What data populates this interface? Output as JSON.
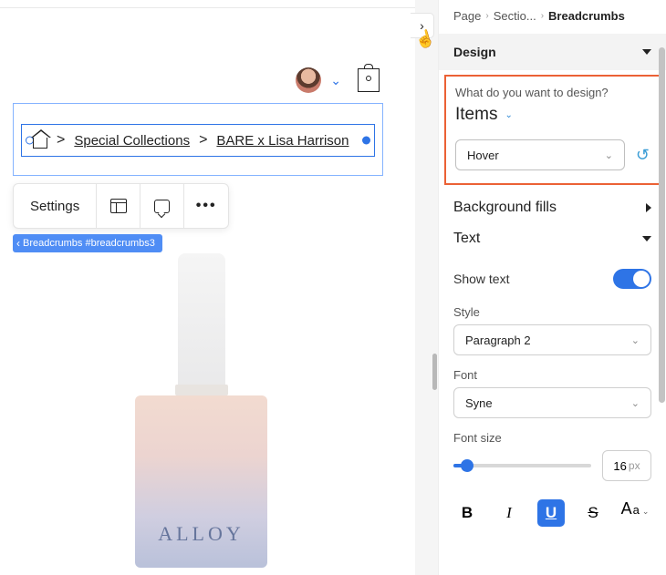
{
  "canvas": {
    "breadcrumb": {
      "link1": "Special Collections",
      "link2": "BARE x Lisa Harrison"
    },
    "toolbar": {
      "settings": "Settings"
    },
    "tag": "Breadcrumbs #breadcrumbs3",
    "brand": "ALLOY"
  },
  "panel": {
    "crumbs": {
      "a": "Page",
      "b": "Sectio...",
      "c": "Breadcrumbs"
    },
    "design": {
      "title": "Design",
      "question": "What do you want to design?",
      "target": "Items",
      "state": "Hover"
    },
    "bg": "Background fills",
    "text": {
      "title": "Text",
      "show_label": "Show text",
      "style_label": "Style",
      "style_value": "Paragraph 2",
      "font_label": "Font",
      "font_value": "Syne",
      "size_label": "Font size",
      "size_value": "16",
      "size_unit": "px"
    },
    "format": {
      "b": "B",
      "i": "I",
      "u": "U",
      "s": "S",
      "aa_big": "A",
      "aa_small": "a"
    }
  }
}
